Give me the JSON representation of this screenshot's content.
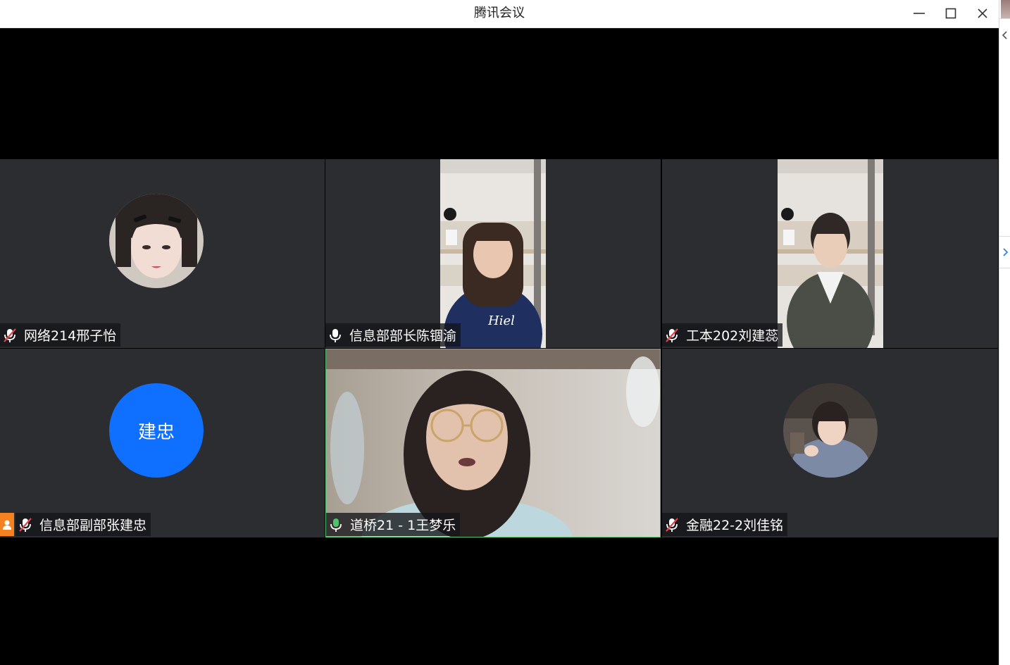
{
  "window": {
    "title": "腾讯会议",
    "minimize_label": "minimize",
    "maximize_label": "maximize",
    "close_label": "close"
  },
  "participants": [
    {
      "name": "网络214邢子怡",
      "mic": "muted",
      "view": "avatar-photo"
    },
    {
      "name": "信息部部长陈锢渝",
      "mic": "on",
      "view": "video"
    },
    {
      "name": "工本202刘建蕊",
      "mic": "muted",
      "view": "video"
    },
    {
      "name": "信息部副部张建忠",
      "mic": "muted",
      "view": "avatar-initials",
      "initials": "建忠",
      "host": true
    },
    {
      "name": "道桥21 - 1王梦乐",
      "mic": "speaking",
      "view": "video",
      "active": true
    },
    {
      "name": "金融22-2刘佳铭",
      "mic": "muted",
      "view": "avatar-photo"
    }
  ],
  "icons": {
    "mic_on": "microphone-icon",
    "mic_muted": "microphone-muted-icon",
    "mic_speaking": "microphone-speaking-icon",
    "host": "host-person-icon"
  },
  "colors": {
    "tile_bg": "#2b2d31",
    "speaking_green": "#4fc26a",
    "initials_blue": "#0f6fff",
    "host_orange": "#f58220",
    "muted_red": "#e0434b"
  }
}
